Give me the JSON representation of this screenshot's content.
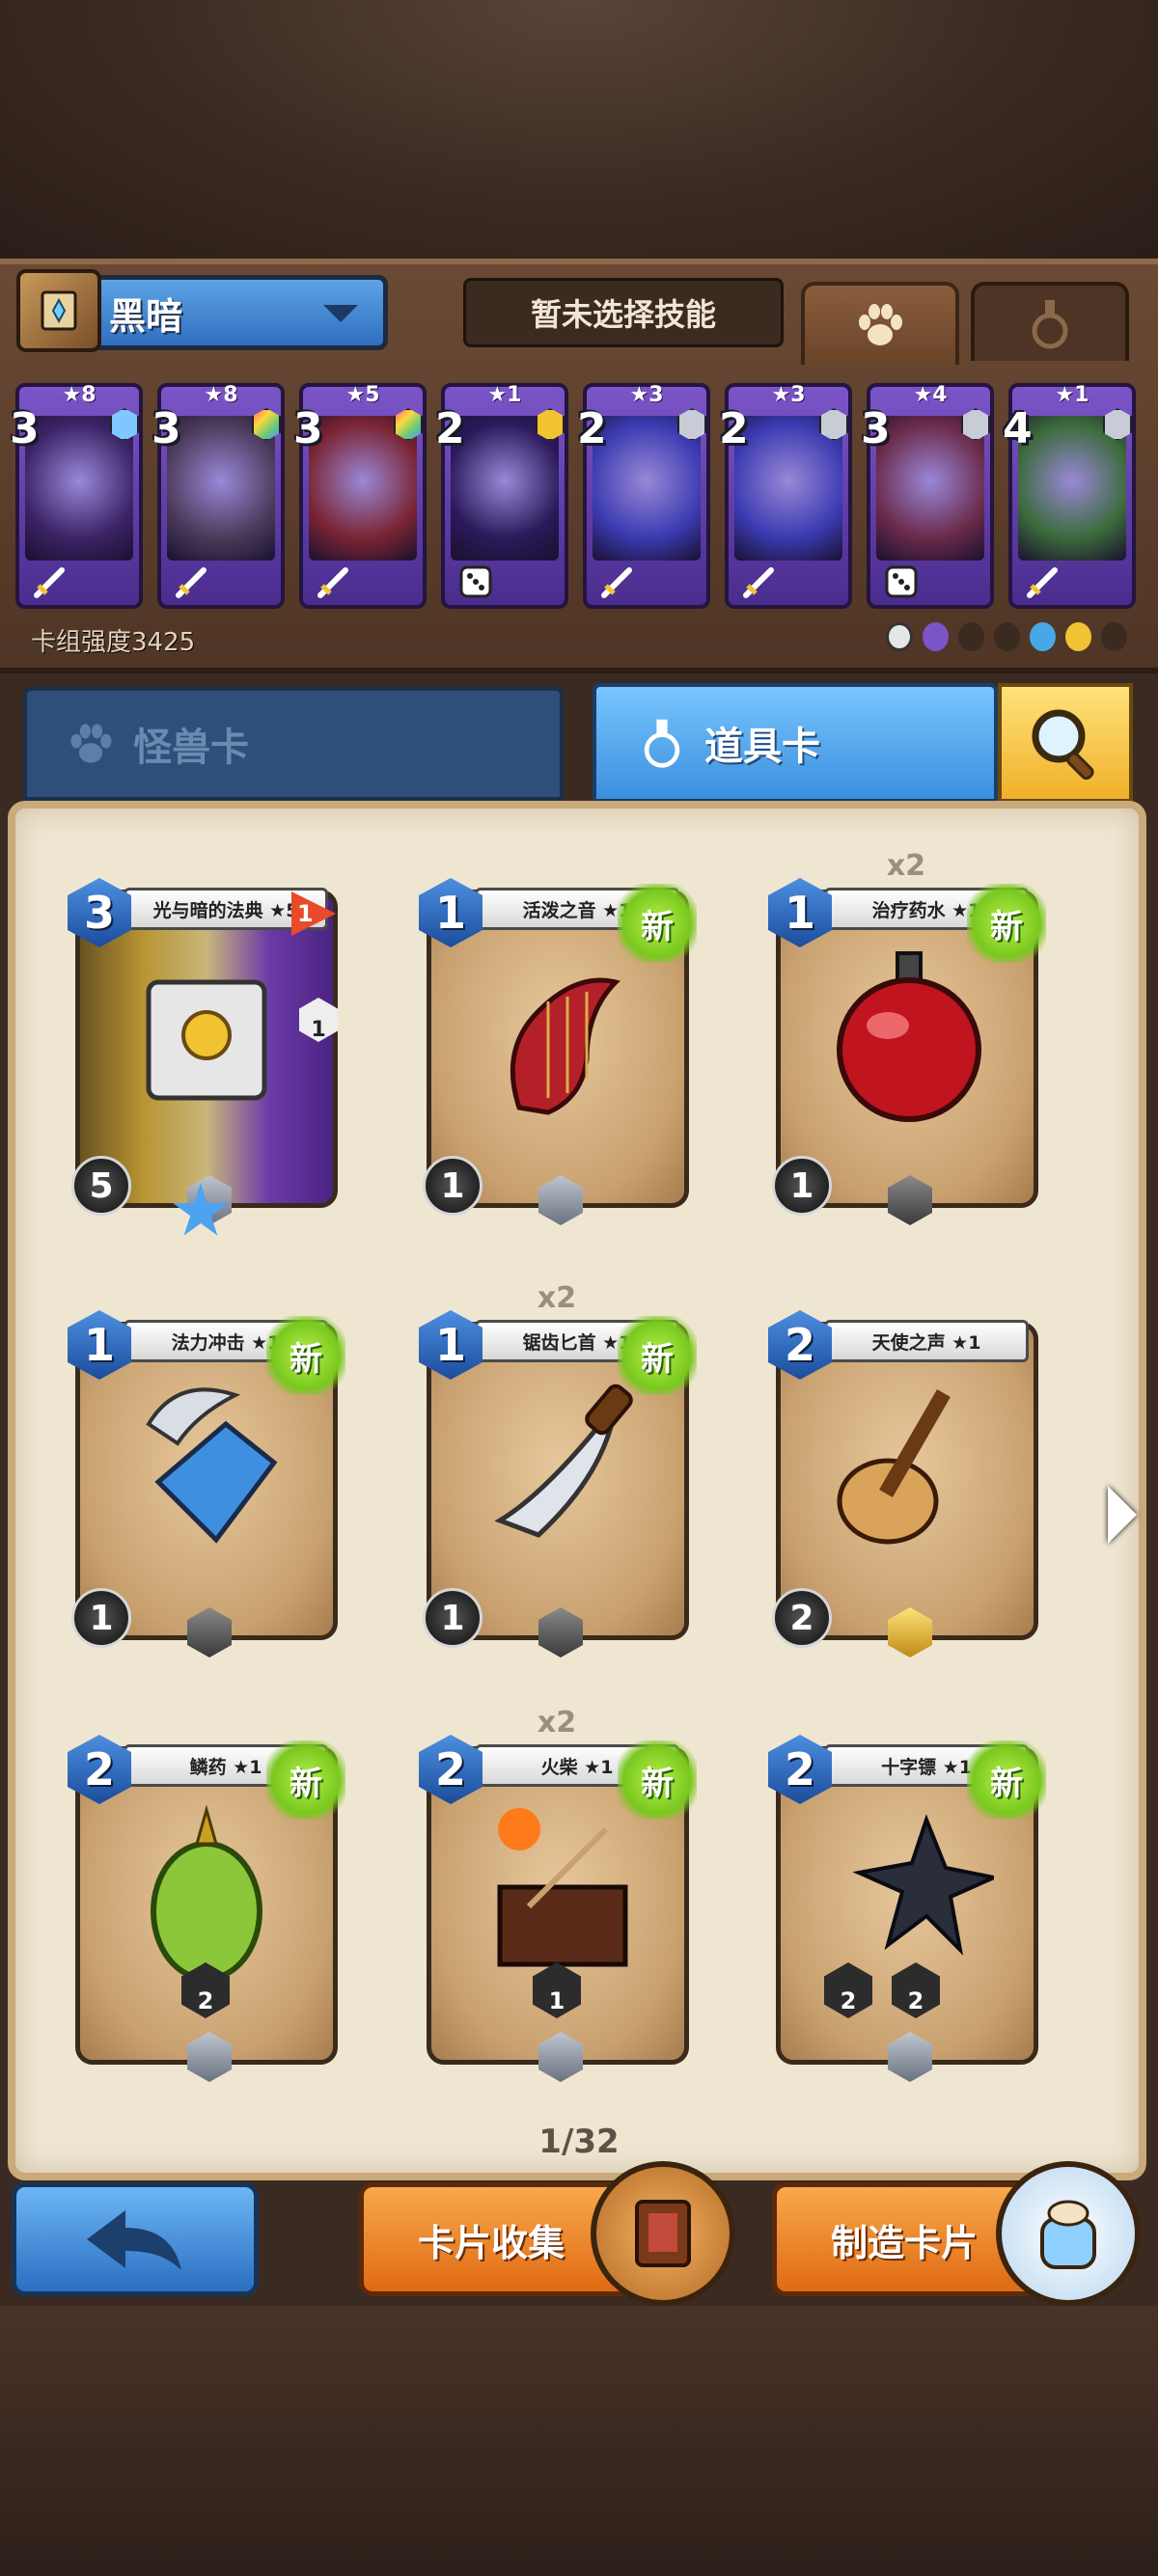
{
  "header": {
    "faction": "黑暗",
    "skill_placeholder": "暂未选择技能",
    "tabs": [
      {
        "icon": "paw-icon",
        "active": true
      },
      {
        "icon": "potion-icon",
        "active": false
      }
    ]
  },
  "deck": {
    "cards": [
      {
        "stars": "★8",
        "cost": "3",
        "gem": "star",
        "foot": "sword"
      },
      {
        "stars": "★8",
        "cost": "3",
        "gem": "rainbow",
        "foot": "sword"
      },
      {
        "stars": "★5",
        "cost": "3",
        "gem": "rainbow",
        "foot": "sword"
      },
      {
        "stars": "★1",
        "cost": "2",
        "gem": "gold",
        "foot": "dice"
      },
      {
        "stars": "★3",
        "cost": "2",
        "gem": "silver",
        "foot": "sword"
      },
      {
        "stars": "★3",
        "cost": "2",
        "gem": "silver",
        "foot": "sword"
      },
      {
        "stars": "★4",
        "cost": "3",
        "gem": "silver",
        "foot": "dice"
      },
      {
        "stars": "★1",
        "cost": "4",
        "gem": "silver",
        "foot": "sword"
      }
    ],
    "power_label": "卡组强度3425"
  },
  "type_tabs": {
    "monster": "怪兽卡",
    "item": "道具卡"
  },
  "collection": {
    "cards": [
      {
        "name": "光与暗的法典 ★5",
        "cost": "3",
        "stat": "5",
        "new": "",
        "copies": "",
        "gem": "silver"
      },
      {
        "name": "活泼之音 ★1",
        "cost": "1",
        "stat": "1",
        "new": "新",
        "copies": "",
        "gem": "silver"
      },
      {
        "name": "治疗药水 ★1",
        "cost": "1",
        "stat": "1",
        "new": "新",
        "copies": "x2",
        "gem": "dark"
      },
      {
        "name": "法力冲击 ★1",
        "cost": "1",
        "stat": "1",
        "new": "新",
        "copies": "",
        "gem": "dark"
      },
      {
        "name": "锯齿匕首 ★1",
        "cost": "1",
        "stat": "1",
        "new": "新",
        "copies": "x2",
        "gem": "dark"
      },
      {
        "name": "天使之声 ★1",
        "cost": "2",
        "stat": "2",
        "new": "",
        "copies": "",
        "gem": "gold"
      },
      {
        "name": "鳞药 ★1",
        "cost": "2",
        "stat": "",
        "new": "新",
        "copies": "",
        "gem": "silver",
        "badge": "2"
      },
      {
        "name": "火柴 ★1",
        "cost": "2",
        "stat": "",
        "new": "新",
        "copies": "x2",
        "gem": "silver",
        "badge": "1"
      },
      {
        "name": "十字镖 ★1",
        "cost": "2",
        "stat": "",
        "new": "新",
        "copies": "",
        "gem": "silver",
        "badge": "2",
        "badge2": "2"
      }
    ],
    "page": "1/32"
  },
  "special_card": {
    "flag": "1",
    "side": "1"
  },
  "footer": {
    "collect_label": "卡片收集",
    "craft_label": "制造卡片"
  },
  "colors": {
    "accent_blue": "#3b8fdd",
    "orange": "#e06a14",
    "new_green": "#79c81e",
    "rare_purple": "#6b3aa8"
  }
}
